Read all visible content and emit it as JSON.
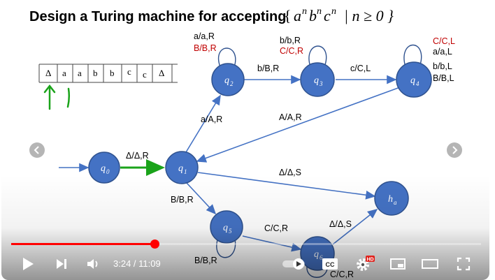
{
  "slide": {
    "title": "Design a Turing machine for accepting",
    "title_math_open": "{",
    "title_math_a": "a",
    "title_math_b": "b",
    "title_math_c": "c",
    "title_math_exp": "n",
    "title_math_cond": "| n ≥ 0 }",
    "tape_cells": [
      "Δ",
      "a",
      "a",
      "b",
      "b",
      "c",
      "c",
      "Δ"
    ],
    "states": {
      "q0": "q",
      "q0_sub": "0",
      "q1": "q",
      "q1_sub": "1",
      "q2": "q",
      "q2_sub": "2",
      "q3": "q",
      "q3_sub": "3",
      "q4": "q",
      "q4_sub": "4",
      "q5": "q",
      "q5_sub": "5",
      "q6": "q",
      "q6_sub": "6",
      "ha": "h",
      "ha_sub": "a"
    },
    "transitions": {
      "q0_q1": "Δ/Δ,R",
      "q1_q2": "a/A,R",
      "q2_loop_1": "a/a,R",
      "q2_loop_2": "B/B,R",
      "q2_q3": "b/B,R",
      "q3_loop_1": "b/b,R",
      "q3_loop_2": "C/C,R",
      "q3_q4": "c/C,L",
      "q4_loop_1": "C/C,L",
      "q4_loop_2": "a/a,L",
      "q4_loop_3": "b/b,L",
      "q4_loop_4": "B/B,L",
      "q4_q1": "A/A,R",
      "q1_ha": "Δ/Δ,S",
      "q1_q5": "B/B,R",
      "q5_loop": "B/B,R",
      "q5_q6": "C/C,R",
      "q6_ha": "Δ/Δ,S",
      "q6_loop": "C/C,R"
    }
  },
  "player": {
    "current_time": "3:24",
    "separator": " / ",
    "duration": "11:09",
    "progress_fraction": 0.305,
    "cc_label": "CC",
    "hd_badge": "HD"
  },
  "colors": {
    "accent": "#ff0000",
    "state_fill": "#4472c4",
    "red_text": "#c00000",
    "green_marks": "#1aa31a"
  }
}
